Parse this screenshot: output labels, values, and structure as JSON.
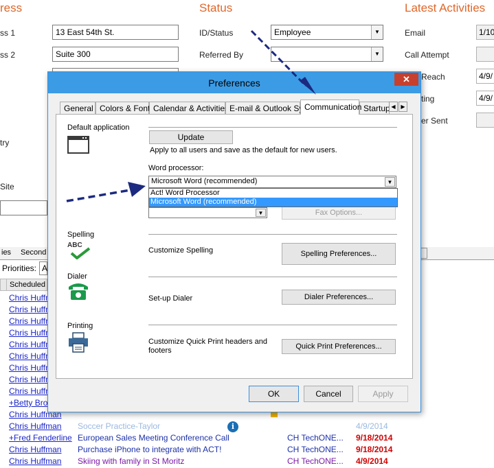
{
  "background": {
    "sections": {
      "address": "ress",
      "status": "Status",
      "latest": "Latest Activities"
    },
    "address_labels": [
      "ss 1",
      "ss 2",
      "try",
      "Site"
    ],
    "address_values": [
      "13 East 54th St.",
      "Suite 300"
    ],
    "status_labels": [
      "ID/Status",
      "Referred By"
    ],
    "status_value": "Employee",
    "latest_labels": [
      "Email",
      "Call Attempt",
      "Reach",
      "ting",
      "er Sent"
    ],
    "latest_values": [
      "1/10",
      "4/9/",
      "4/9/"
    ],
    "tabs": [
      "ies",
      "Second"
    ],
    "priorities_label": "Priorities:",
    "priorities_value": "A",
    "scheduled_header": "Scheduled",
    "rows": [
      {
        "who": "Chris Huffman"
      },
      {
        "who": "Chris Huffman"
      },
      {
        "who": "Chris Huffman"
      },
      {
        "who": "Chris Huffman"
      },
      {
        "who": "Chris Huffman"
      },
      {
        "who": "Chris Huffman"
      },
      {
        "who": "Chris Huffman"
      },
      {
        "who": "Chris Huffman"
      },
      {
        "who": "Chris Huffman"
      },
      {
        "who": "+Betty Brow"
      },
      {
        "who": "Chris Huffman"
      },
      {
        "who": "Chris Huffman",
        "regarding": "Soccer Practice-Taylor",
        "company": "",
        "date": "4/9/2014"
      },
      {
        "who": "+Fred Fenderline",
        "regarding": "European Sales Meeting Conference Call",
        "company": "CH TechONE...",
        "date": "9/18/2014"
      },
      {
        "who": "Chris Huffman",
        "regarding": "Purchase iPhone to integrate with ACT!",
        "company": "CH TechONE...",
        "date": "9/18/2014"
      },
      {
        "who": "Chris Huffman",
        "regarding": "Skiing with family in St Moritz",
        "company": "CH TechONE...",
        "date": "4/9/2014"
      }
    ]
  },
  "dialog": {
    "title": "Preferences",
    "close": "✕",
    "tabs": [
      "General",
      "Colors & Fonts",
      "Calendar & Activities",
      "E-mail & Outlook Sync",
      "Communication",
      "Startup"
    ],
    "active_tab": "Communication",
    "default_app": {
      "label": "Default application",
      "update_button": "Update",
      "apply_text": "Apply to all users and save as the default for new users.",
      "word_label": "Word processor:",
      "word_value": "Microsoft Word (recommended)",
      "options": [
        "Act! Word Processor",
        "Microsoft Word (recommended)"
      ],
      "selected_option": "Microsoft Word (recommended)",
      "fax_options_button": "Fax Options..."
    },
    "spelling": {
      "label": "Spelling",
      "icon_text": "ABC",
      "text": "Customize Spelling",
      "button": "Spelling Preferences..."
    },
    "dialer": {
      "label": "Dialer",
      "text": "Set-up Dialer",
      "button": "Dialer Preferences..."
    },
    "printing": {
      "label": "Printing",
      "text": "Customize Quick Print headers and footers",
      "button": "Quick Print Preferences..."
    },
    "footer": {
      "ok": "OK",
      "cancel": "Cancel",
      "apply": "Apply"
    }
  },
  "colors": {
    "accent_orange": "#e0672a",
    "title_bar": "#3c9be5",
    "selection": "#3399ff",
    "link": "#1a24c8",
    "arrow": "#1c2a80"
  }
}
